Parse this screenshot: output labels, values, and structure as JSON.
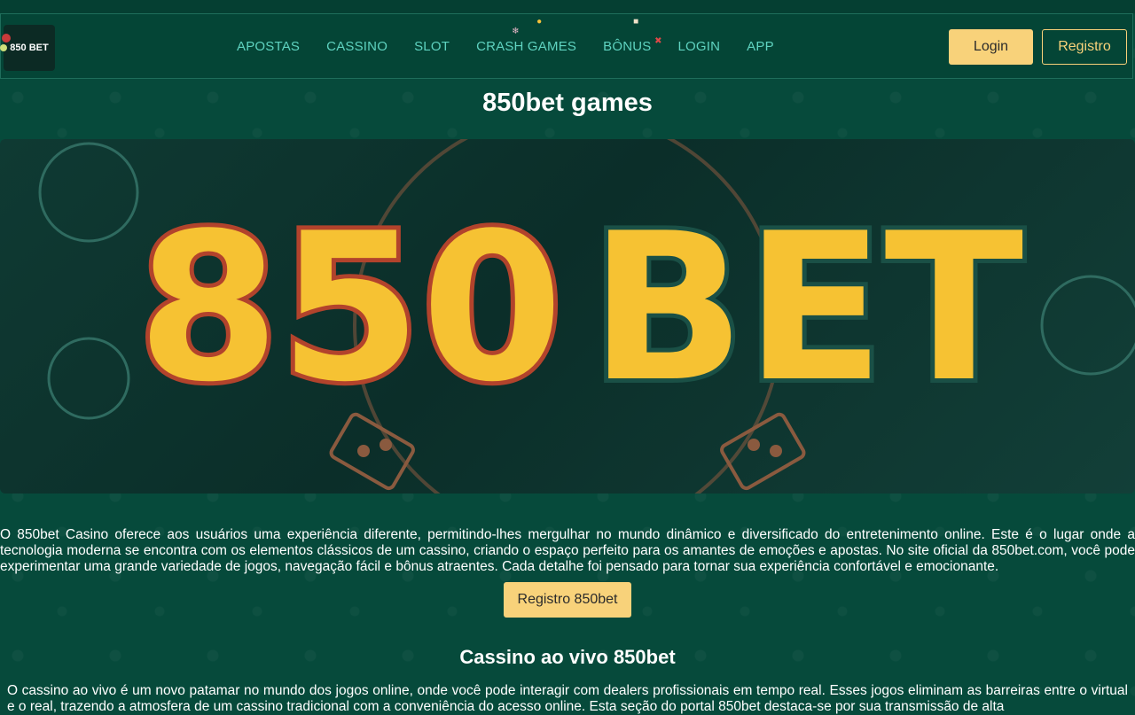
{
  "header": {
    "logo_text": "850 BET",
    "nav": [
      "APOSTAS",
      "CASSINO",
      "SLOT",
      "CRASH GAMES",
      "BÔNUS",
      "LOGIN",
      "APP"
    ],
    "login_label": "Login",
    "register_label": "Registro"
  },
  "main": {
    "title": "850bet games",
    "banner_text_left": "850",
    "banner_text_right": "BET",
    "intro": "O 850bet Casino oferece aos usuários uma experiência diferente, permitindo-lhes mergulhar no mundo dinâmico e diversificado do entretenimento online. Este é o lugar onde a tecnologia moderna se encontra com os elementos clássicos de um cassino, criando o espaço perfeito para os amantes de emoções e apostas. No site oficial da 850bet.com, você pode experimentar uma grande variedade de jogos, navegação fácil e bônus atraentes. Cada detalhe foi pensado para tornar sua experiência confortável e emocionante.",
    "cta_label": "Registro 850bet",
    "section_title": "Cassino ao vivo 850bet",
    "section_text": "O cassino ao vivo é um novo patamar no mundo dos jogos online, onde você pode interagir com dealers profissionais em tempo real. Esses jogos eliminam as barreiras entre o virtual e o real, trazendo a atmosfera de um cassino tradicional com a conveniência do acesso online. Esta seção do portal 850bet destaca-se por sua transmissão de alta"
  },
  "colors": {
    "background": "#064a3b",
    "accent": "#f8d27a",
    "nav_text": "#5fd3c0"
  }
}
